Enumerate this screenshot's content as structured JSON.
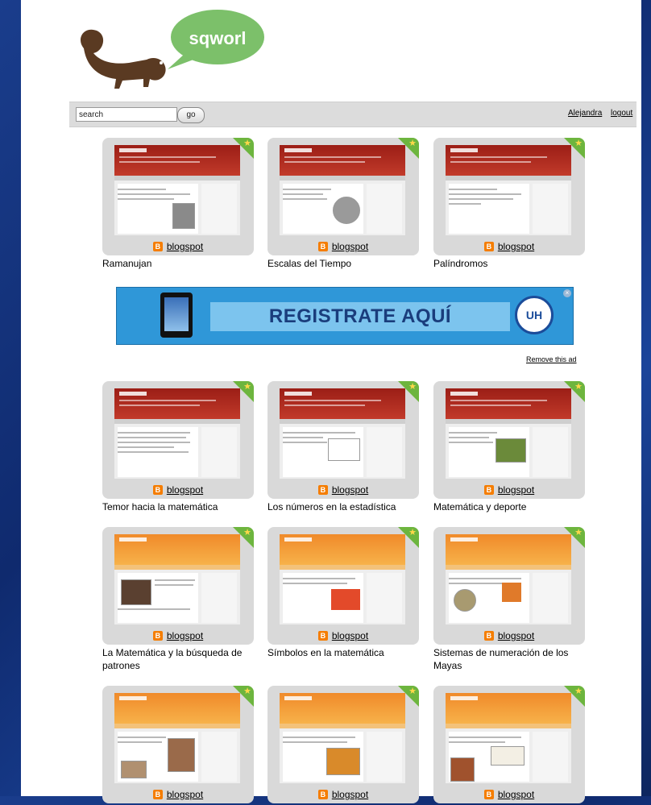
{
  "app": {
    "logo_text": "sqworl"
  },
  "toolbar": {
    "search_value": "search",
    "go_label": "go",
    "user_label": "Alejandra",
    "logout_label": "logout"
  },
  "ad": {
    "headline": "REGISTRATE AQUÍ",
    "logo_letters": "UH",
    "remove_label": "Remove this ad"
  },
  "colors": {
    "background": "#1a3d8c",
    "logo_bubble": "#7cc06a",
    "logo_squirrel": "#5a3a22",
    "corner_badge": "#6db53e",
    "ad_blue": "#2f97d8"
  },
  "cards": [
    {
      "source": "blogspot",
      "caption": "Ramanujan",
      "theme": "red",
      "icon": "blogger-icon"
    },
    {
      "source": "blogspot",
      "caption": "Escalas del Tiempo",
      "theme": "red",
      "icon": "blogger-icon"
    },
    {
      "source": "blogspot",
      "caption": "Palíndromos",
      "theme": "red",
      "icon": "blogger-icon"
    },
    {
      "source": "blogspot",
      "caption": "Temor hacia la matemática",
      "theme": "red",
      "icon": "blogger-icon"
    },
    {
      "source": "blogspot",
      "caption": "Los números en la estadística",
      "theme": "red",
      "icon": "blogger-icon"
    },
    {
      "source": "blogspot",
      "caption": "Matemática y deporte",
      "theme": "red",
      "icon": "blogger-icon"
    },
    {
      "source": "blogspot",
      "caption": "La Matemática y la búsqueda de patrones",
      "theme": "orange",
      "icon": "blogger-icon"
    },
    {
      "source": "blogspot",
      "caption": "Símbolos en la matemática",
      "theme": "orange",
      "icon": "blogger-icon"
    },
    {
      "source": "blogspot",
      "caption": "Sistemas de numeración de los Mayas",
      "theme": "orange",
      "icon": "blogger-icon"
    },
    {
      "source": "blogspot",
      "caption": "",
      "theme": "orange",
      "icon": "blogger-icon"
    },
    {
      "source": "blogspot",
      "caption": "",
      "theme": "orange",
      "icon": "blogger-icon"
    },
    {
      "source": "blogspot",
      "caption": "",
      "theme": "orange",
      "icon": "blogger-icon"
    }
  ]
}
